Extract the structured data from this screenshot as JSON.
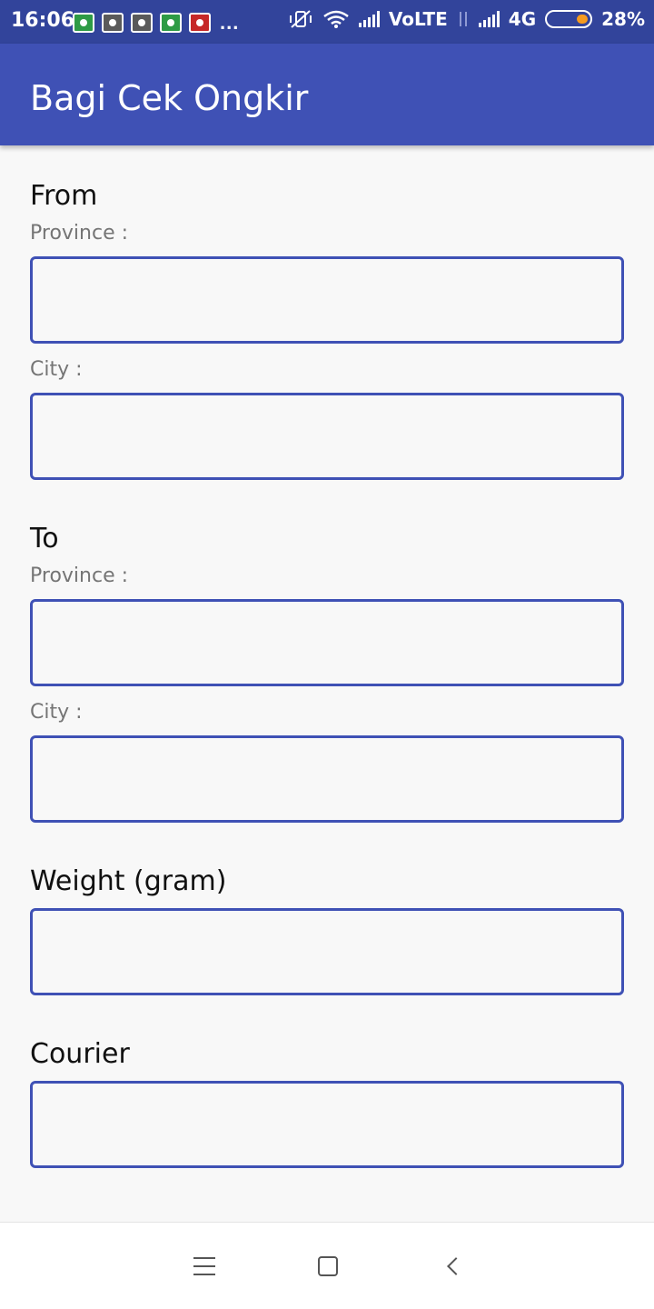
{
  "status_bar": {
    "time": "16:06",
    "network_label": "VoLTE",
    "data_label": "4G",
    "battery_text": "28%",
    "battery_level": 0.28,
    "notification_icons": [
      "whatsapp-icon",
      "camera-icon",
      "camera-icon",
      "android-icon",
      "app-icon"
    ],
    "overflow": "..."
  },
  "app_bar": {
    "title": "Bagi Cek Ongkir"
  },
  "form": {
    "from_heading": "From",
    "from_province_label": "Province :",
    "from_city_label": "City :",
    "to_heading": "To",
    "to_province_label": "Province :",
    "to_city_label": "City :",
    "weight_heading": "Weight (gram)",
    "courier_heading": "Courier",
    "from_province_value": "",
    "from_city_value": "",
    "to_province_value": "",
    "to_city_value": "",
    "weight_value": "",
    "courier_value": ""
  },
  "colors": {
    "primary": "#3f51b5",
    "primary_dark": "#32449b",
    "background": "#f8f8f8",
    "label_gray": "#757575",
    "battery_accent": "#f59b1f"
  },
  "nav_bar": {
    "icons": [
      "menu-icon",
      "home-icon",
      "back-icon"
    ]
  }
}
